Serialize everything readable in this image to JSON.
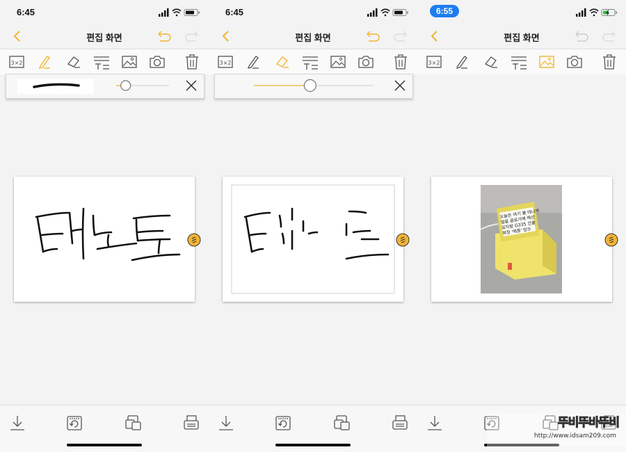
{
  "colors": {
    "accent": "#f2b434",
    "ink": "#222222",
    "status_pill": "#1e7cf0"
  },
  "panels": [
    {
      "time": "6:45",
      "title": "편집 화면",
      "active_tool": "pen",
      "popup": "pen-options",
      "slider_level": 0.18
    },
    {
      "time": "6:45",
      "title": "편집 화면",
      "active_tool": "eraser",
      "popup": "eraser-options",
      "slider_level": 0.47
    },
    {
      "time": "6:55",
      "title": "편집 화면",
      "active_tool": "image",
      "popup": "none"
    }
  ],
  "toolbar_icons": [
    "grid-3x2-icon",
    "pen-icon",
    "eraser-icon",
    "text-icon",
    "image-icon",
    "camera-icon",
    "trash-icon"
  ],
  "toolbar_grid_label": "3×2",
  "bottom_icons": [
    "download-icon",
    "rotate-icon",
    "pages-icon",
    "printer-icon"
  ],
  "photo_note": {
    "lines": [
      "오늘은 여기 볼 테니까",
      "얼음 음료가에 에선",
      "로지랑 G335 건물",
      "복장 '에몽' 망쓰"
    ]
  },
  "watermark": {
    "logo": "뚜비뚜바뚜비",
    "url": "http://www.idsam209.com"
  }
}
